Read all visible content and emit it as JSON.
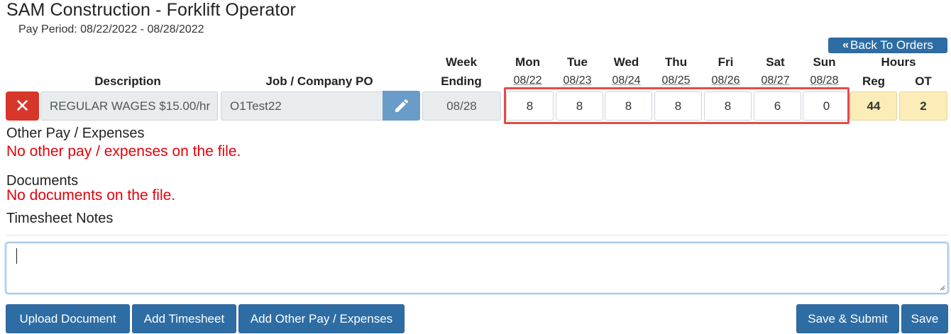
{
  "page": {
    "title": "SAM Construction - Forklift Operator",
    "pay_period": "Pay Period: 08/22/2022 - 08/28/2022",
    "back_button": "Back To Orders"
  },
  "table": {
    "headers": {
      "description": "Description",
      "job_po": "Job / Company PO",
      "week": "Week",
      "ending": "Ending",
      "hours": "Hours",
      "reg": "Reg",
      "ot": "OT"
    },
    "days": [
      {
        "name": "Mon",
        "date": "08/22",
        "value": "8"
      },
      {
        "name": "Tue",
        "date": "08/23",
        "value": "8"
      },
      {
        "name": "Wed",
        "date": "08/24",
        "value": "8"
      },
      {
        "name": "Thu",
        "date": "08/25",
        "value": "8"
      },
      {
        "name": "Fri",
        "date": "08/26",
        "value": "8"
      },
      {
        "name": "Sat",
        "date": "08/27",
        "value": "6"
      },
      {
        "name": "Sun",
        "date": "08/28",
        "value": "0"
      }
    ],
    "row": {
      "description": "REGULAR WAGES $15.00/hr",
      "job_po": "O1Test22",
      "week_ending": "08/28",
      "reg_hours": "44",
      "ot_hours": "2"
    }
  },
  "sections": {
    "other_pay_title": "Other Pay / Expenses",
    "other_pay_empty": "No other pay / expenses on the file.",
    "documents_title": "Documents",
    "documents_empty": "No documents on the file.",
    "notes_title": "Timesheet Notes",
    "notes_value": ""
  },
  "buttons": {
    "upload": "Upload Document",
    "add_timesheet": "Add Timesheet",
    "add_other_pay": "Add Other Pay / Expenses",
    "save_submit": "Save & Submit",
    "save": "Save"
  },
  "colors": {
    "primary": "#2e6da4",
    "danger": "#d9362b",
    "error_text": "#e8000b",
    "hours_bg": "#fcedb8",
    "highlight": "#e24b4b"
  },
  "icons": {
    "delete": "close-icon",
    "edit": "pencil-icon",
    "back": "double-chevron-left-icon"
  }
}
